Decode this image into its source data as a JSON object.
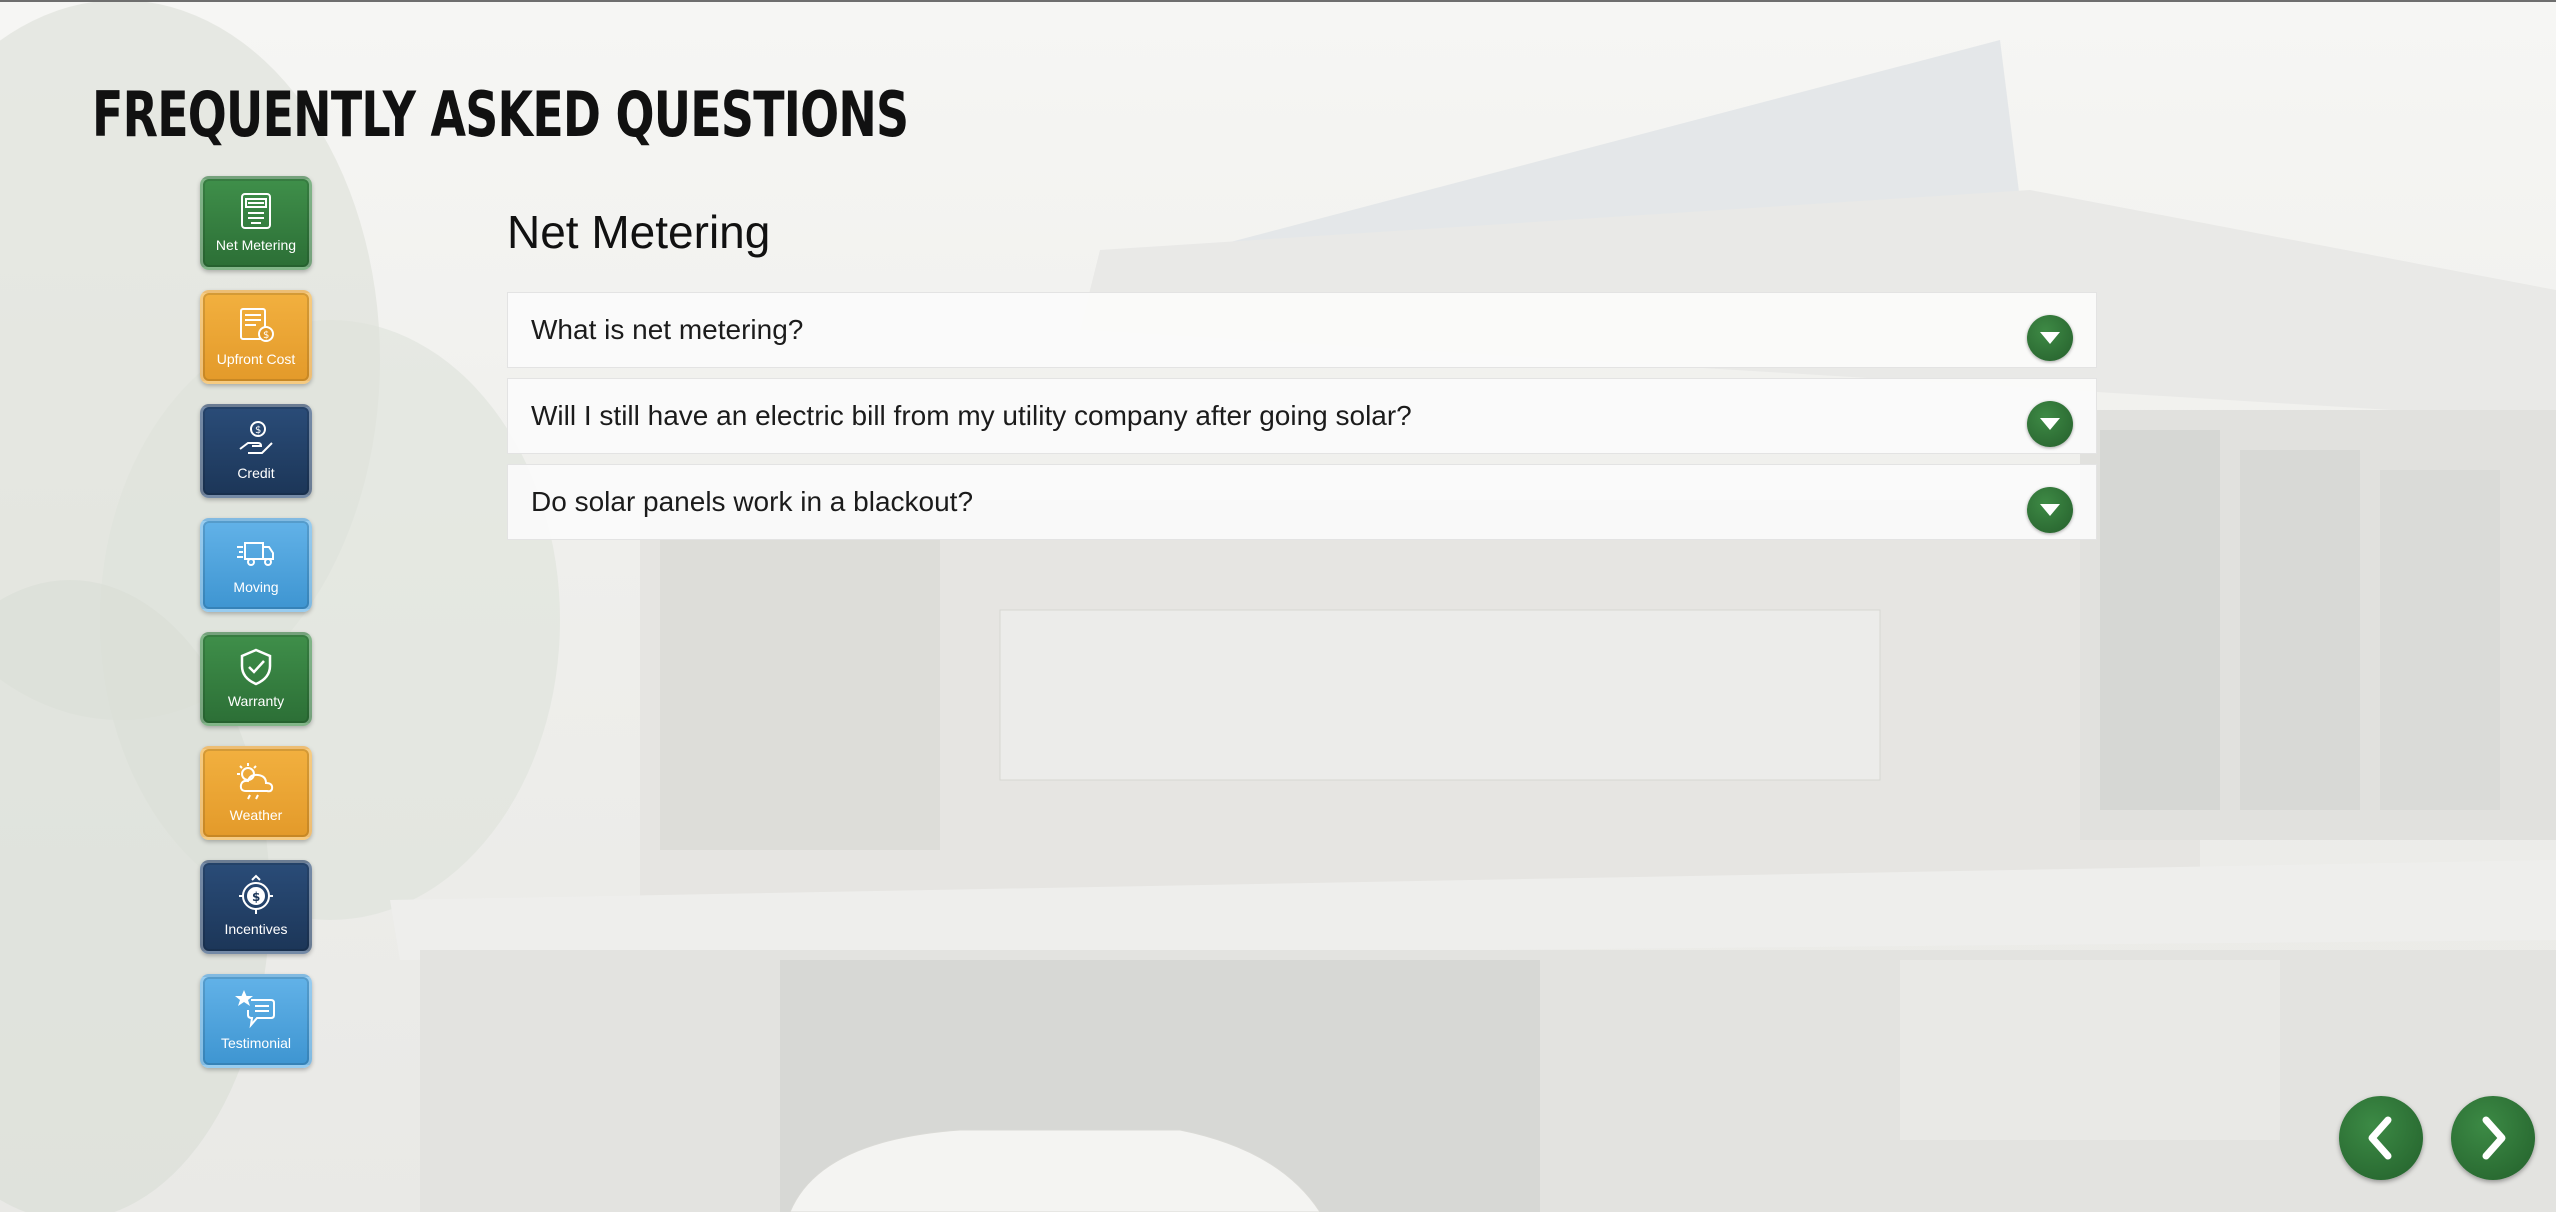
{
  "page": {
    "title": "FREQUENTLY ASKED QUESTIONS"
  },
  "categories": [
    {
      "label": "Net Metering",
      "icon": "meter-icon",
      "color": "#2f7a3a"
    },
    {
      "label": "Upfront Cost",
      "icon": "invoice-icon",
      "color": "#f0a530"
    },
    {
      "label": "Credit",
      "icon": "hand-dollar-icon",
      "color": "#1f3d66"
    },
    {
      "label": "Moving",
      "icon": "truck-icon",
      "color": "#4aa3dd"
    },
    {
      "label": "Warranty",
      "icon": "shield-check-icon",
      "color": "#2f7a3a"
    },
    {
      "label": "Weather",
      "icon": "sun-cloud-icon",
      "color": "#f0a530"
    },
    {
      "label": "Incentives",
      "icon": "dollar-badge-icon",
      "color": "#1f3d66"
    },
    {
      "label": "Testimonial",
      "icon": "star-chat-icon",
      "color": "#4aa3dd"
    }
  ],
  "faq": {
    "section_title": "Net Metering",
    "questions": [
      {
        "text": "What is net metering?"
      },
      {
        "text": "Will I still have an electric bill from my utility company after going solar?"
      },
      {
        "text": "Do solar panels work in a blackout?"
      }
    ]
  },
  "navigation": {
    "prev_icon": "chevron-left-icon",
    "next_icon": "chevron-right-icon"
  },
  "colors": {
    "accent_green": "#2f7a3a",
    "accent_orange": "#f0a530",
    "accent_navy": "#1f3d66",
    "accent_blue": "#4aa3dd"
  }
}
